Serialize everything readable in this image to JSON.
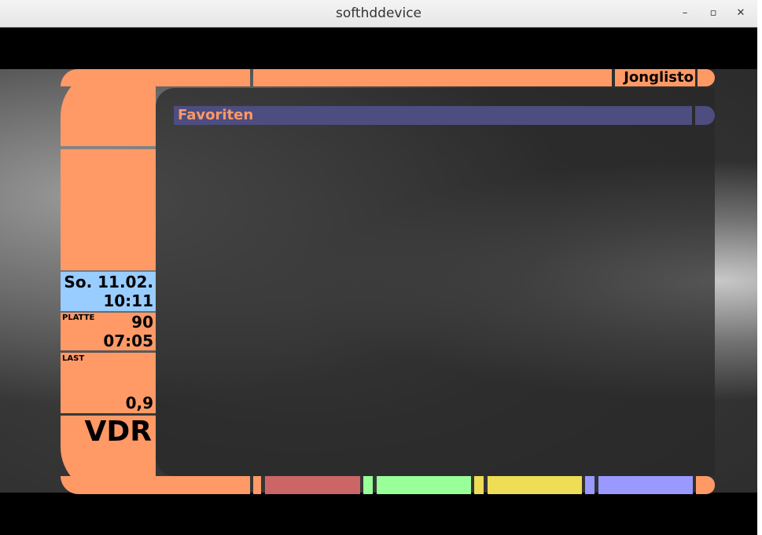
{
  "window": {
    "title": "softhddevice",
    "minimize_glyph": "–",
    "maximize_glyph": "▫",
    "close_glyph": "✕"
  },
  "osd": {
    "menu_title": "Jonglisto",
    "list_title": "Favoriten",
    "date": "So. 11.02.",
    "time": "10:11",
    "disk_label": "PLATTE",
    "disk_percent": "90",
    "disk_time": "07:05",
    "load_label": "LAST",
    "load_value": "0,9",
    "brand": "VDR"
  },
  "colors": {
    "frame": "#ff9966",
    "title_bar": "#4d4d80",
    "date_bg": "#99ccff",
    "red_key": "#cc6666",
    "green_key": "#99ff99",
    "yellow_key": "#eedd55",
    "blue_key": "#9999ff"
  }
}
